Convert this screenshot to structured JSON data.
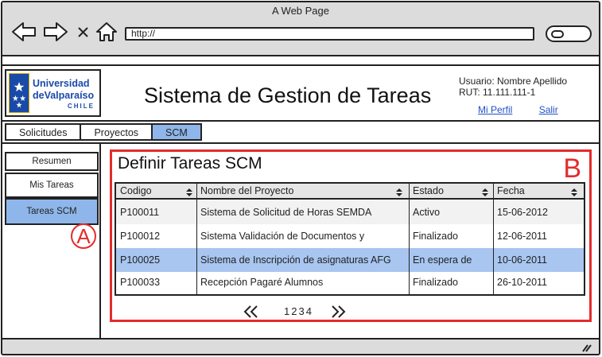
{
  "browser": {
    "title": "A Web Page",
    "url": "http://"
  },
  "header": {
    "logo": {
      "line1": "Universidad",
      "line2": "deValparaíso",
      "line3": "CHILE"
    },
    "app_title": "Sistema de Gestion de Tareas",
    "user_line": "Usuario: Nombre Apellido",
    "rut_line": "RUT: 11.111.111-1",
    "profile_link": "Mi Perfil",
    "logout_link": "Salir"
  },
  "tabs": [
    {
      "label": "Solicitudes",
      "active": false
    },
    {
      "label": "Proyectos",
      "active": false
    },
    {
      "label": "SCM",
      "active": true
    }
  ],
  "sidebar": {
    "items": [
      {
        "label": "Resumen",
        "active": false
      },
      {
        "label": "Mis Tareas",
        "active": false
      },
      {
        "label": "Tareas SCM",
        "active": true
      }
    ],
    "annotation": "A"
  },
  "panel": {
    "title": "Definir Tareas SCM",
    "annotation": "B",
    "columns": [
      "Codigo",
      "Nombre del Proyecto",
      "Estado",
      "Fecha"
    ],
    "rows": [
      {
        "codigo": "P100011",
        "nombre": "Sistema de Solicitud de Horas SEMDA",
        "estado": "Activo",
        "fecha": "15-06-2012",
        "selected": false
      },
      {
        "codigo": "P100012",
        "nombre": "Sistema Validación de Documentos y",
        "estado": "Finalizado",
        "fecha": "12-06-2011",
        "selected": false
      },
      {
        "codigo": "P100025",
        "nombre": "Sistema de Inscripción de asignaturas AFG",
        "estado": "En espera de",
        "fecha": "10-06-2011",
        "selected": true
      },
      {
        "codigo": "P100033",
        "nombre": "Recepción Pagaré Alumnos",
        "estado": "Finalizado",
        "fecha": "26-10-2011",
        "selected": false
      }
    ],
    "pager": {
      "pages": "1234"
    }
  },
  "colors": {
    "selection": "#a8c6f0",
    "annotation": "#e52b2b",
    "link": "#1f50c8"
  }
}
